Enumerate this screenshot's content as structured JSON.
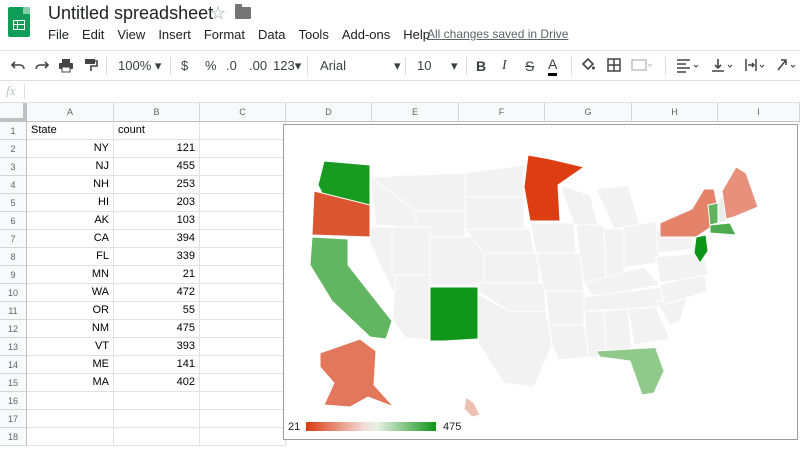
{
  "app": {
    "title": "Untitled spreadsheet",
    "menu": [
      "File",
      "Edit",
      "View",
      "Insert",
      "Format",
      "Data",
      "Tools",
      "Add-ons",
      "Help"
    ],
    "saved_status": "All changes saved in Drive",
    "colors": {
      "brand_green": "#0f9d58",
      "low": "#dc3912",
      "high": "#109618"
    }
  },
  "toolbar": {
    "zoom": "100%",
    "currency": "$",
    "percent": "%",
    "dec_less": ".0",
    "dec_more": ".00",
    "more_formats": "123",
    "font": "Arial",
    "font_size": "10",
    "bold": "B",
    "italic": "I",
    "strike": "S",
    "text_color": "A",
    "icons": [
      "undo-icon",
      "redo-icon",
      "print-icon",
      "paint-format-icon",
      "fill-color-icon",
      "borders-icon",
      "merge-icon",
      "align-icon",
      "valign-icon",
      "wrap-icon",
      "rotate-icon"
    ]
  },
  "formula_bar": {
    "fx": "fx",
    "value": ""
  },
  "columns": [
    "A",
    "B",
    "C",
    "D",
    "E",
    "F",
    "G",
    "H",
    "I"
  ],
  "rows": [
    "1",
    "2",
    "3",
    "4",
    "5",
    "6",
    "7",
    "8",
    "9",
    "10",
    "11",
    "12",
    "13",
    "14",
    "15",
    "16",
    "17",
    "18"
  ],
  "table": {
    "headers": [
      "State",
      "count"
    ],
    "rows": [
      [
        "NY",
        "121"
      ],
      [
        "NJ",
        "455"
      ],
      [
        "NH",
        "253"
      ],
      [
        "HI",
        "203"
      ],
      [
        "AK",
        "103"
      ],
      [
        "CA",
        "394"
      ],
      [
        "FL",
        "339"
      ],
      [
        "MN",
        "21"
      ],
      [
        "WA",
        "472"
      ],
      [
        "OR",
        "55"
      ],
      [
        "NM",
        "475"
      ],
      [
        "VT",
        "393"
      ],
      [
        "ME",
        "141"
      ],
      [
        "MA",
        "402"
      ]
    ]
  },
  "chart_data": {
    "type": "geo",
    "region": "US",
    "color_axis": {
      "min": 21,
      "max": 475,
      "min_label": "21",
      "max_label": "475",
      "colors": [
        "#dc3912",
        "#109618"
      ]
    },
    "values": {
      "NY": 121,
      "NJ": 455,
      "NH": 253,
      "HI": 203,
      "AK": 103,
      "CA": 394,
      "FL": 339,
      "MN": 21,
      "WA": 472,
      "OR": 55,
      "NM": 475,
      "VT": 393,
      "ME": 141,
      "MA": 402
    }
  }
}
